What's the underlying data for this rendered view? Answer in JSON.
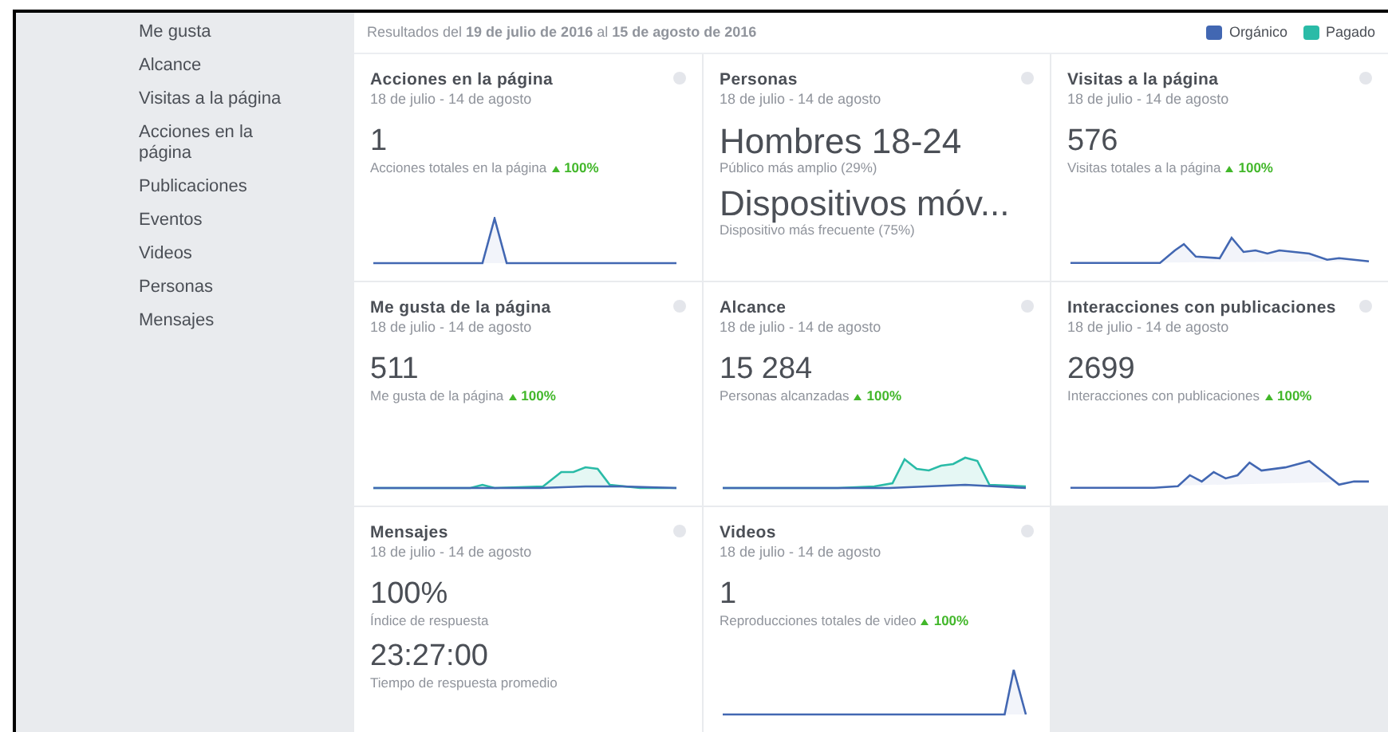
{
  "sidebar": {
    "items": [
      {
        "label": "Me gusta"
      },
      {
        "label": "Alcance"
      },
      {
        "label": "Visitas a la página"
      },
      {
        "label": "Acciones en la página"
      },
      {
        "label": "Publicaciones"
      },
      {
        "label": "Eventos"
      },
      {
        "label": "Videos"
      },
      {
        "label": "Personas"
      },
      {
        "label": "Mensajes"
      }
    ]
  },
  "header": {
    "results": "Resultados del **19 de julio de 2016** al **15 de agosto de 2016**",
    "legend": [
      {
        "label": "Orgánico",
        "color": "#4267b2"
      },
      {
        "label": "Pagado",
        "color": "#2abba7"
      }
    ]
  },
  "cards": [
    {
      "title": "Acciones en la página",
      "dates": "18 de julio - 14 de agosto",
      "metrics": [
        {
          "kind": "big",
          "value": "1",
          "label": "Acciones totales en la página",
          "change": "100%"
        }
      ],
      "organic_line": true
    },
    {
      "title": "Personas",
      "dates": "18 de julio - 14 de agosto",
      "metrics": [
        {
          "kind": "big",
          "value": "Hombres 18-24",
          "label": "Público más amplio (29%)"
        },
        {
          "kind": "big",
          "value": "Dispositivos móv...",
          "label": "Dispositivo más frecuente (75%)"
        }
      ]
    },
    {
      "title": "Visitas a la página",
      "dates": "18 de julio - 14 de agosto",
      "metrics": [
        {
          "kind": "big",
          "value": "576",
          "label": "Visitas totales a la página",
          "change": "100%"
        }
      ],
      "organic_line": true
    },
    {
      "title": "Me gusta de la página",
      "dates": "18 de julio - 14 de agosto",
      "metrics": [
        {
          "kind": "big",
          "value": "511",
          "label": "Me gusta de la página",
          "change": "100%"
        }
      ],
      "organic_line": true,
      "paid_line": true
    },
    {
      "title": "Alcance",
      "dates": "18 de julio - 14 de agosto",
      "metrics": [
        {
          "kind": "big",
          "value": "15 284",
          "label": "Personas alcanzadas",
          "change": "100%"
        }
      ],
      "organic_line": true,
      "paid_line": true
    },
    {
      "title": "Interacciones con publicaciones",
      "dates": "18 de julio - 14 de agosto",
      "metrics": [
        {
          "kind": "big",
          "value": "2699",
          "label": "Interacciones con publicaciones",
          "change": "100%"
        }
      ],
      "organic_line": true
    },
    {
      "title": "Mensajes",
      "dates": "18 de julio - 14 de agosto",
      "metrics": [
        {
          "kind": "big",
          "value": "100%",
          "label": "Índice de respuesta"
        },
        {
          "kind": "big",
          "value": "23:27:00",
          "label": "Tiempo de respuesta promedio"
        }
      ]
    },
    {
      "title": "Videos",
      "dates": "18 de julio - 14 de agosto",
      "metrics": [
        {
          "kind": "big",
          "value": "1",
          "label": "Reproducciones totales de video",
          "change": "100%"
        }
      ],
      "organic_line": true
    }
  ]
}
